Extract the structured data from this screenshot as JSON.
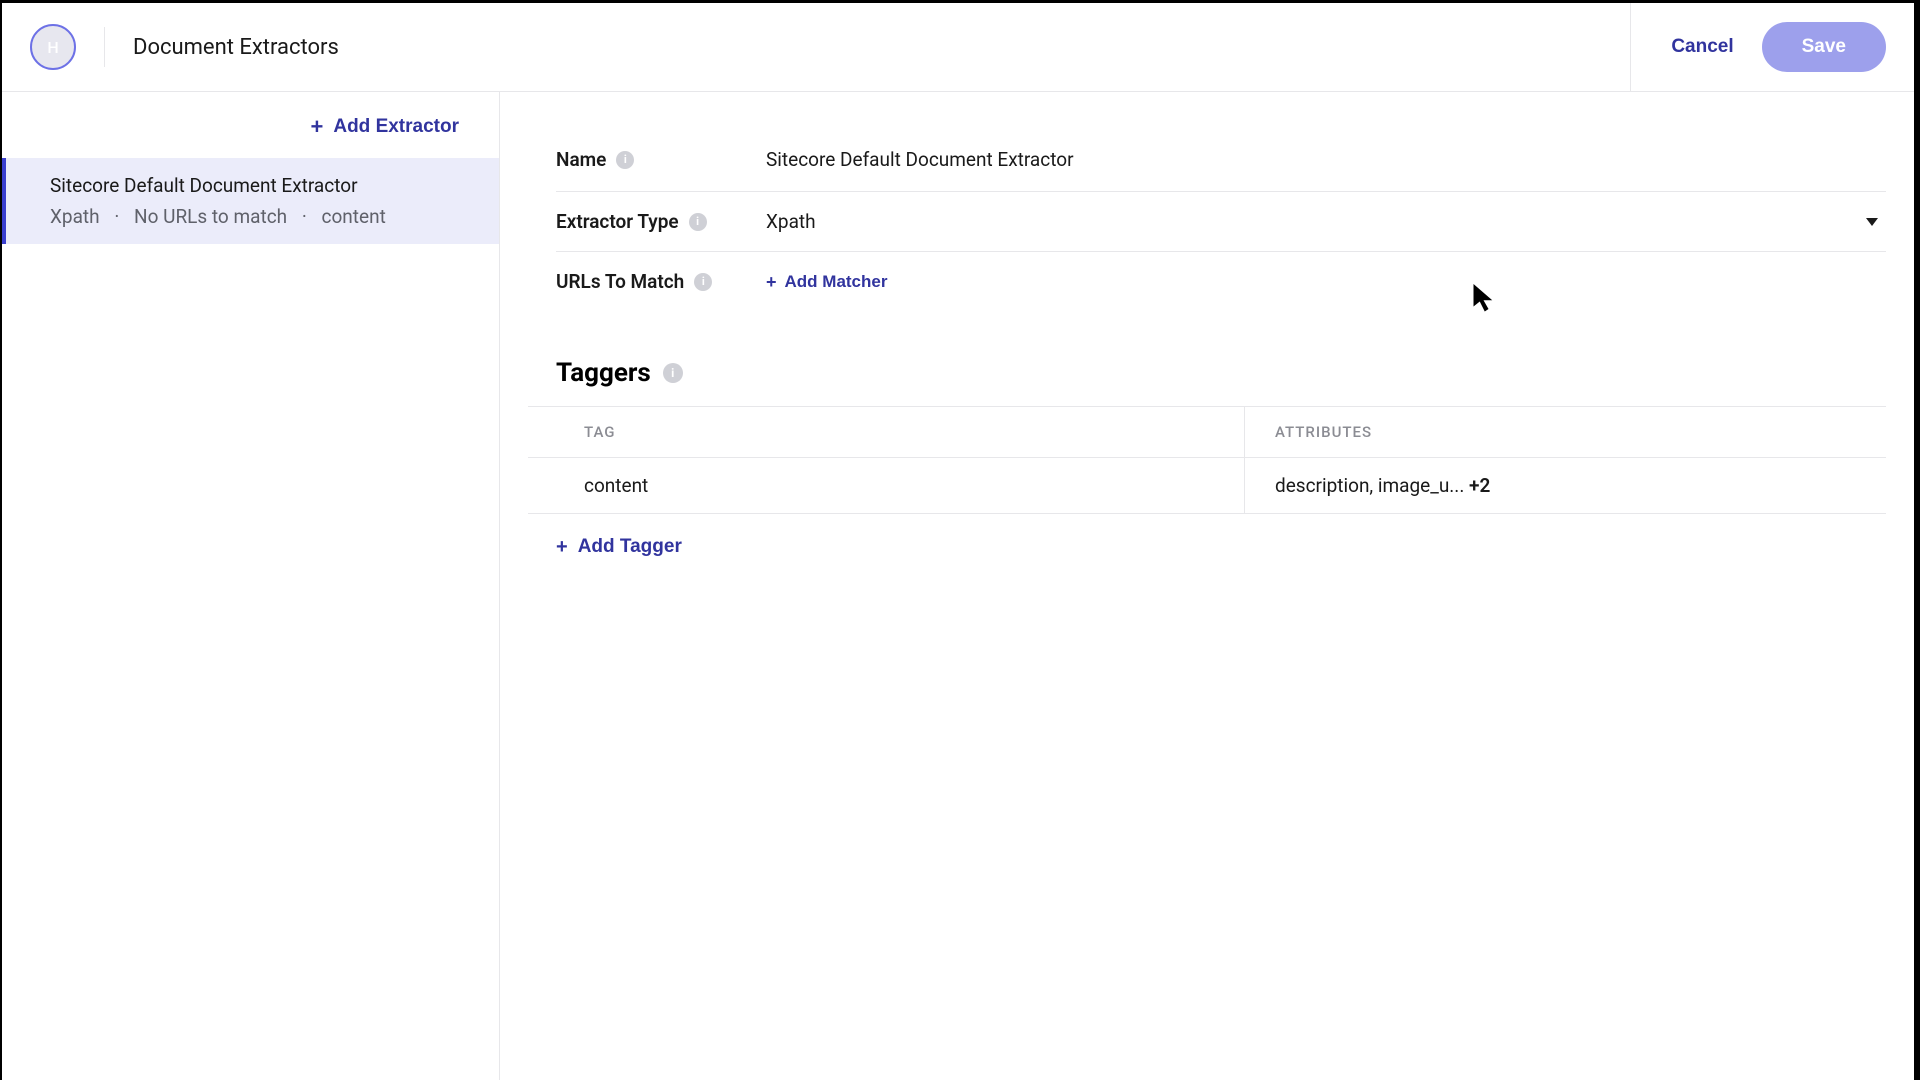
{
  "header": {
    "avatar_initial": "H",
    "title": "Document Extractors",
    "cancel_label": "Cancel",
    "save_label": "Save"
  },
  "sidebar": {
    "add_extractor_label": "Add Extractor",
    "item": {
      "title": "Sitecore Default Document Extractor",
      "meta_type": "Xpath",
      "meta_urls": "No URLs to match",
      "meta_tagger": "content"
    }
  },
  "fields": {
    "name_label": "Name",
    "name_value": "Sitecore Default Document Extractor",
    "extractor_type_label": "Extractor Type",
    "extractor_type_value": "Xpath",
    "urls_label": "URLs To Match",
    "add_matcher_label": "Add Matcher"
  },
  "taggers": {
    "section_label": "Taggers",
    "head_tag": "TAG",
    "head_attr": "ATTRIBUTES",
    "row_tag": "content",
    "row_attr_text": "description, image_u...",
    "row_attr_more": "+2",
    "add_tagger_label": "Add Tagger"
  }
}
